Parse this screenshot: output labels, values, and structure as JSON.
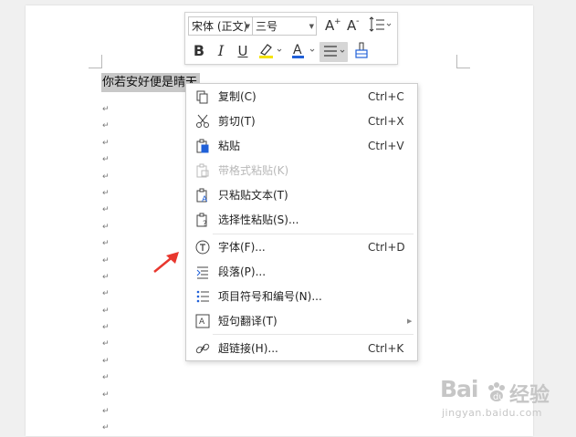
{
  "document": {
    "selected_text": "你若安好便是晴天",
    "paragraph_mark": "↵",
    "paragraph_mark_count": 20
  },
  "mini_toolbar": {
    "font_name": "宋体 (正文)",
    "font_size": "三号",
    "grow_font_glyph": "A⁺",
    "shrink_font_glyph": "A⁻",
    "bold_glyph": "B",
    "italic_glyph": "I",
    "underline_glyph": "U",
    "font_color_glyph": "A",
    "font_color_underline": "#2060d8",
    "highlight_color_underline": "#f5e300"
  },
  "context_menu": {
    "items": [
      {
        "label": "复制(C)",
        "shortcut": "Ctrl+C",
        "icon": "copy-icon",
        "enabled": true
      },
      {
        "label": "剪切(T)",
        "shortcut": "Ctrl+X",
        "icon": "scissors-icon",
        "enabled": true
      },
      {
        "label": "粘贴",
        "shortcut": "Ctrl+V",
        "icon": "paste-icon",
        "enabled": true
      },
      {
        "label": "带格式粘贴(K)",
        "shortcut": "",
        "icon": "paste-format-icon",
        "enabled": false
      },
      {
        "label": "只粘贴文本(T)",
        "shortcut": "",
        "icon": "paste-text-icon",
        "enabled": true
      },
      {
        "label": "选择性粘贴(S)...",
        "shortcut": "",
        "icon": "paste-special-icon",
        "enabled": true
      },
      {
        "label": "字体(F)...",
        "shortcut": "Ctrl+D",
        "icon": "font-icon",
        "enabled": true
      },
      {
        "label": "段落(P)...",
        "shortcut": "",
        "icon": "paragraph-icon",
        "enabled": true
      },
      {
        "label": "项目符号和编号(N)...",
        "shortcut": "",
        "icon": "bullets-numbering-icon",
        "enabled": true
      },
      {
        "label": "短句翻译(T)",
        "shortcut": "",
        "icon": "translate-icon",
        "enabled": true,
        "submenu": true
      },
      {
        "label": "超链接(H)...",
        "shortcut": "Ctrl+K",
        "icon": "hyperlink-icon",
        "enabled": true
      }
    ]
  },
  "annotation": {
    "arrow_color": "#e8372e"
  },
  "watermark": {
    "logo_left": "Bai",
    "logo_suffix": "经验",
    "url": "jingyan.baidu.com"
  }
}
